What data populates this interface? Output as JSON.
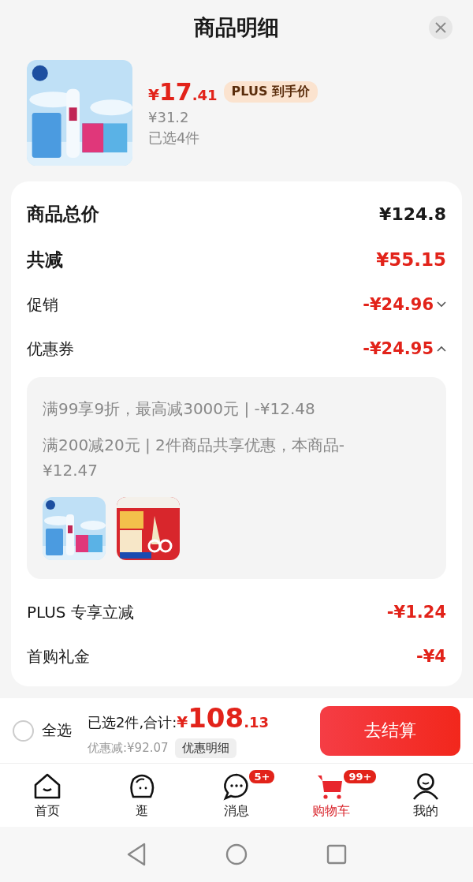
{
  "title": "商品明细",
  "product": {
    "currency": "¥",
    "price_int": "17",
    "price_dec": ".41",
    "badge": "PLUS 到手价",
    "original_price": "¥31.2",
    "selected_count": "已选4件"
  },
  "breakdown": [
    {
      "kind": "total",
      "label": "商品总价",
      "value": "¥124.8"
    },
    {
      "kind": "reduction",
      "label": "共减",
      "value": "¥55.15"
    },
    {
      "kind": "expandable",
      "label": "促销",
      "value": "-¥24.96",
      "expanded": false
    },
    {
      "kind": "expandable",
      "label": "优惠券",
      "value": "-¥24.95",
      "expanded": true,
      "details": {
        "lines": [
          "满99享9折，最高减3000元 | -¥12.48",
          "满200减20元 | 2件商品共享优惠，本商品-¥12.47"
        ]
      }
    },
    {
      "kind": "discount",
      "label": "PLUS 专享立减",
      "value": "-¥1.24"
    },
    {
      "kind": "discount",
      "label": "首购礼金",
      "value": "-¥4"
    }
  ],
  "footer": {
    "select_all": {
      "label": "全选",
      "checked": false
    },
    "summary": "已选2件,合计:",
    "currency": "¥",
    "total_int": "108",
    "total_dec": ".13",
    "discount": "优惠减:¥92.07",
    "detail_button": "优惠明细",
    "checkout": "去结算"
  },
  "tabs": [
    {
      "kind": "home",
      "label": "首页",
      "selected": false
    },
    {
      "kind": "browse",
      "label": "逛",
      "selected": false
    },
    {
      "kind": "message",
      "label": "消息",
      "selected": false,
      "badge": "5+"
    },
    {
      "kind": "cart",
      "label": "购物车",
      "selected": true,
      "badge": "99+"
    },
    {
      "kind": "me",
      "label": "我的",
      "selected": false
    }
  ]
}
